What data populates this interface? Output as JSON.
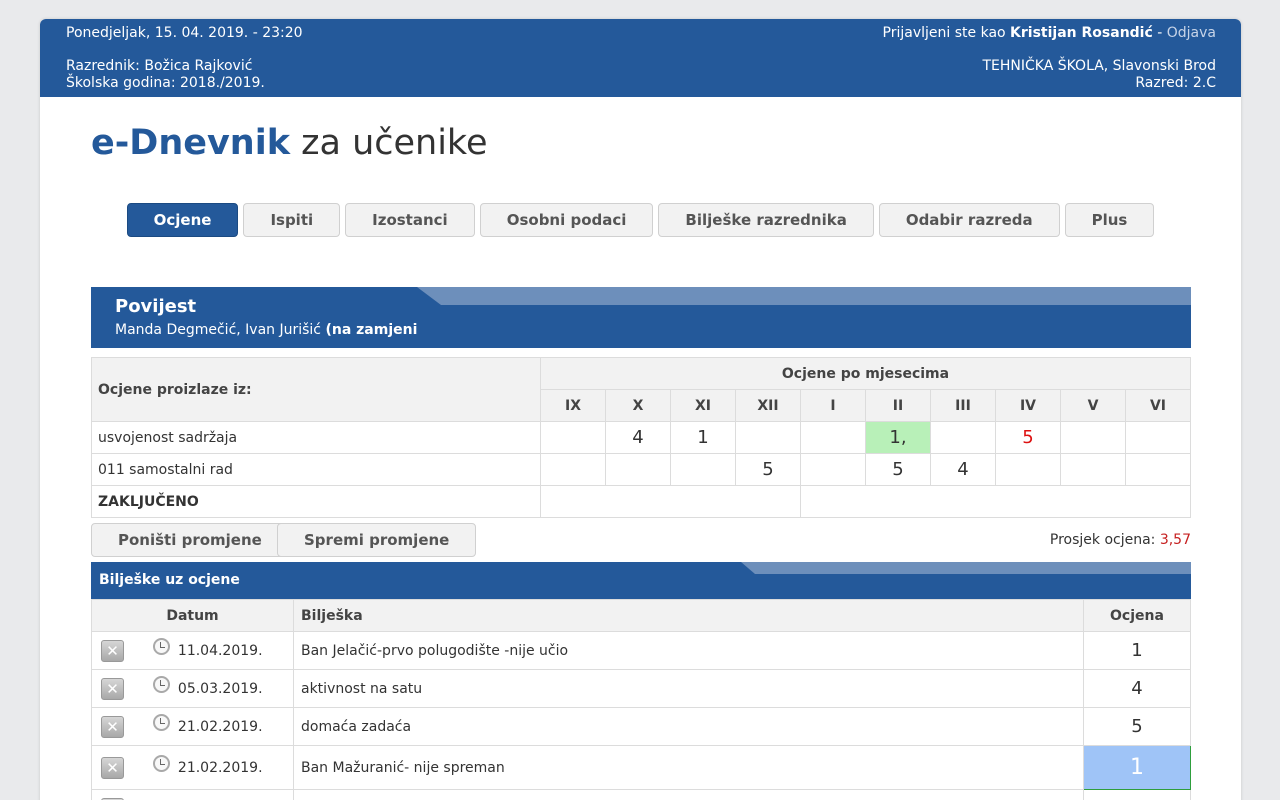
{
  "header": {
    "date_time": "Ponedjeljak, 15. 04. 2019. - 23:20",
    "logged_in_prefix": "Prijavljeni ste kao",
    "user": "Kristijan Rosandić",
    "separator": "-",
    "logout": "Odjava",
    "class_teacher": "Razrednik: Božica Rajković",
    "school_year": "Školska godina: 2018./2019.",
    "school": "TEHNIČKA ŠKOLA, Slavonski Brod",
    "class": "Razred: 2.C"
  },
  "title": {
    "brand": "e-Dnevnik",
    "rest": "za učenike"
  },
  "tabs": [
    "Ocjene",
    "Ispiti",
    "Izostanci",
    "Osobni podaci",
    "Bilješke razrednika",
    "Odabir razreda",
    "Plus"
  ],
  "subject": {
    "name": "Povijest",
    "teachers": "Manda Degmečić, Ivan Jurišić",
    "teachers_note": "(na zamjeni"
  },
  "grades_table": {
    "source_header": "Ocjene proizlaze iz:",
    "months_header": "Ocjene po mjesecima",
    "months": [
      "IX",
      "X",
      "XI",
      "XII",
      "I",
      "II",
      "III",
      "IV",
      "V",
      "VI"
    ],
    "rows": [
      {
        "label": "usvojenost sadržaja",
        "cells": [
          "",
          "4",
          "1",
          "",
          "",
          "1,",
          "",
          "5",
          "",
          ""
        ]
      },
      {
        "label": "011 samostalni rad",
        "cells": [
          "",
          "",
          "",
          "5",
          "",
          "5",
          "4",
          "",
          "",
          ""
        ]
      }
    ],
    "final_label": "ZAKLJUČENO"
  },
  "buttons": {
    "reset": "Poništi promjene",
    "save": "Spremi promjene"
  },
  "average": {
    "label": "Prosjek ocjena:",
    "value": "3,57"
  },
  "notes": {
    "title": "Bilješke uz ocjene",
    "headers": {
      "date": "Datum",
      "note": "Bilješka",
      "grade": "Ocjena"
    },
    "rows": [
      {
        "date": "11.04.2019.",
        "note": "Ban Jelačić-prvo polugodište -nije učio",
        "grade": "1"
      },
      {
        "date": "05.03.2019.",
        "note": "aktivnost na satu",
        "grade": "4"
      },
      {
        "date": "21.02.2019.",
        "note": "domaća zadaća",
        "grade": "5"
      },
      {
        "date": "21.02.2019.",
        "note": "Ban Mažuranić- nije spreman",
        "grade": "1"
      }
    ]
  },
  "colors": {
    "primary": "#24599a",
    "stripe": "#6d8fbb",
    "highlight_green": "#b8f0b8",
    "red": "#dd1111",
    "selected_blue": "#9fc4f7"
  },
  "icons": {
    "delete": "delete-icon",
    "clock": "clock-icon"
  }
}
